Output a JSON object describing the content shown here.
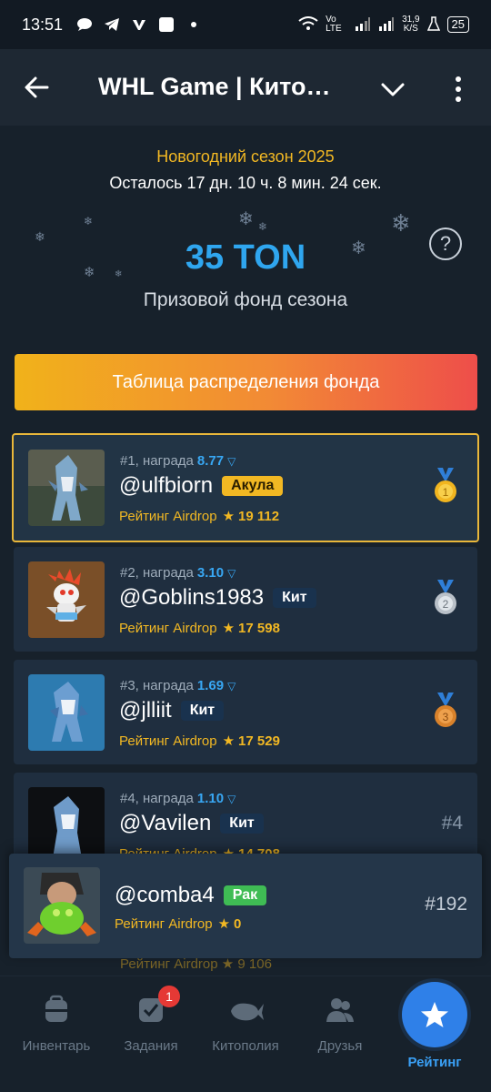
{
  "status_bar": {
    "time": "13:51",
    "network_speed": "31,9\nK/S",
    "network_speed_value": "31,9",
    "network_speed_unit": "K/S",
    "lte_label": "Vo LTE",
    "battery": "25"
  },
  "header": {
    "title": "WHL Game | Кито…"
  },
  "season": {
    "title": "Новогодний сезон 2025",
    "countdown": "Осталось 17 дн. 10 ч. 8 мин. 24 сек."
  },
  "prize": {
    "amount": "35 TON",
    "label": "Призовой фонд сезона",
    "help_symbol": "?"
  },
  "fund_button": {
    "label": "Таблица распределения фонда"
  },
  "leaderboard": [
    {
      "rank_text": "#1, награда",
      "reward": "8.77",
      "username": "@ulfbiorn",
      "badge": "Акула",
      "rating_label": "Рейтинг Airdrop",
      "rating": "19 112",
      "medal": "gold-medal"
    },
    {
      "rank_text": "#2, награда",
      "reward": "3.10",
      "username": "@Goblins1983",
      "badge": "Кит",
      "rating_label": "Рейтинг Airdrop",
      "rating": "17 598",
      "medal": "silver-medal"
    },
    {
      "rank_text": "#3, награда",
      "reward": "1.69",
      "username": "@jlliit",
      "badge": "Кит",
      "rating_label": "Рейтинг Airdrop",
      "rating": "17 529",
      "medal": "bronze-medal"
    },
    {
      "rank_text": "#4, награда",
      "reward": "1.10",
      "username": "@Vavilen",
      "badge": "Кит",
      "rating_label": "Рейтинг Airdrop",
      "rating": "14 708",
      "rank_num": "#4"
    }
  ],
  "faded_row": {
    "rating_label": "Рейтинг Airdrop",
    "rating": "9 106"
  },
  "current_user": {
    "username": "@comba4",
    "badge": "Рак",
    "rating_label": "Рейтинг Airdrop",
    "rating": "0",
    "rank_num": "#192"
  },
  "tabs": [
    {
      "label": "Инвентарь",
      "icon": "backpack-icon"
    },
    {
      "label": "Задания",
      "icon": "tasks-icon",
      "badge": "1"
    },
    {
      "label": "Китополия",
      "icon": "whale-icon"
    },
    {
      "label": "Друзья",
      "icon": "friends-icon"
    },
    {
      "label": "Рейтинг",
      "icon": "star-icon",
      "active": true
    }
  ],
  "colors": {
    "background": "#17212b",
    "accent_gold": "#f2b823",
    "accent_blue": "#2fa6ef",
    "tab_active": "#2f80e8"
  }
}
